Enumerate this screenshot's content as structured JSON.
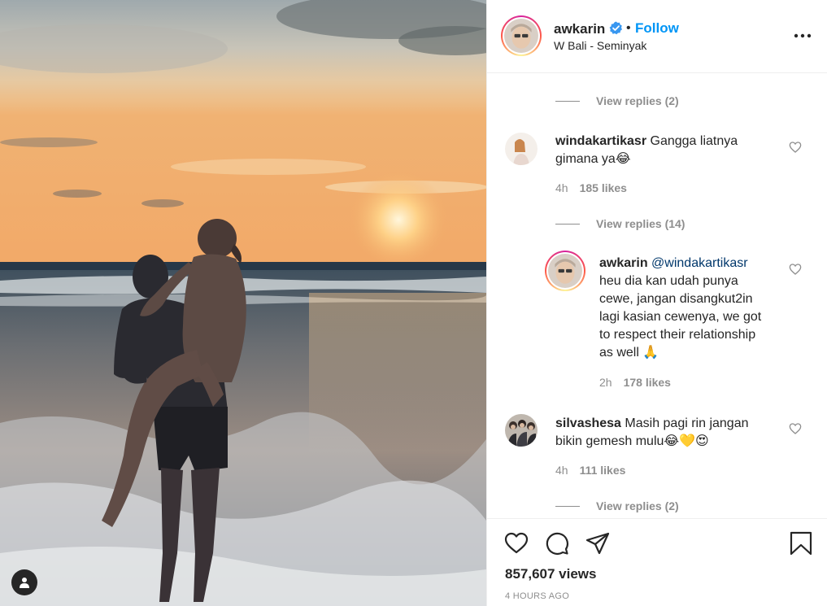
{
  "post": {
    "author": "awkarin",
    "follow_label": "Follow",
    "dot": "•",
    "location": "W Bali - Seminyak"
  },
  "comments": {
    "replies_1": "View replies (2)",
    "c1_user": "windakartikasr",
    "c1_text_1": "Gangga liatnya",
    "c1_text_2": "gimana ya😂",
    "c1_time": "4h",
    "c1_likes": "185 likes",
    "replies_2": "View replies (14)",
    "r1_user": "awkarin",
    "r1_mention": "@windakartikasr",
    "r1_lines": [
      "heu dia kan udah punya",
      "cewe, jangan disangkut2in",
      "lagi kasian cewenya, we got",
      "to respect their relationship",
      "as well 🙏"
    ],
    "r1_time": "2h",
    "r1_likes": "178 likes",
    "c2_user": "silvashesa",
    "c2_text_1": "Masih pagi rin jangan",
    "c2_text_2": "bikin gemesh mulu😂💛😍",
    "c2_time": "4h",
    "c2_likes": "111 likes",
    "replies_3": "View replies (2)"
  },
  "footer": {
    "views": "857,607 views",
    "time_ago": "4 HOURS AGO"
  },
  "icons": {
    "more": "more-options-icon",
    "like": "heart-icon",
    "comment": "comment-icon",
    "share": "share-icon",
    "save": "bookmark-icon",
    "tag": "user-tag-icon",
    "verified": "verified-badge-icon"
  },
  "colors": {
    "follow": "#0095f6",
    "muted": "#8e8e8e",
    "text": "#262626"
  }
}
